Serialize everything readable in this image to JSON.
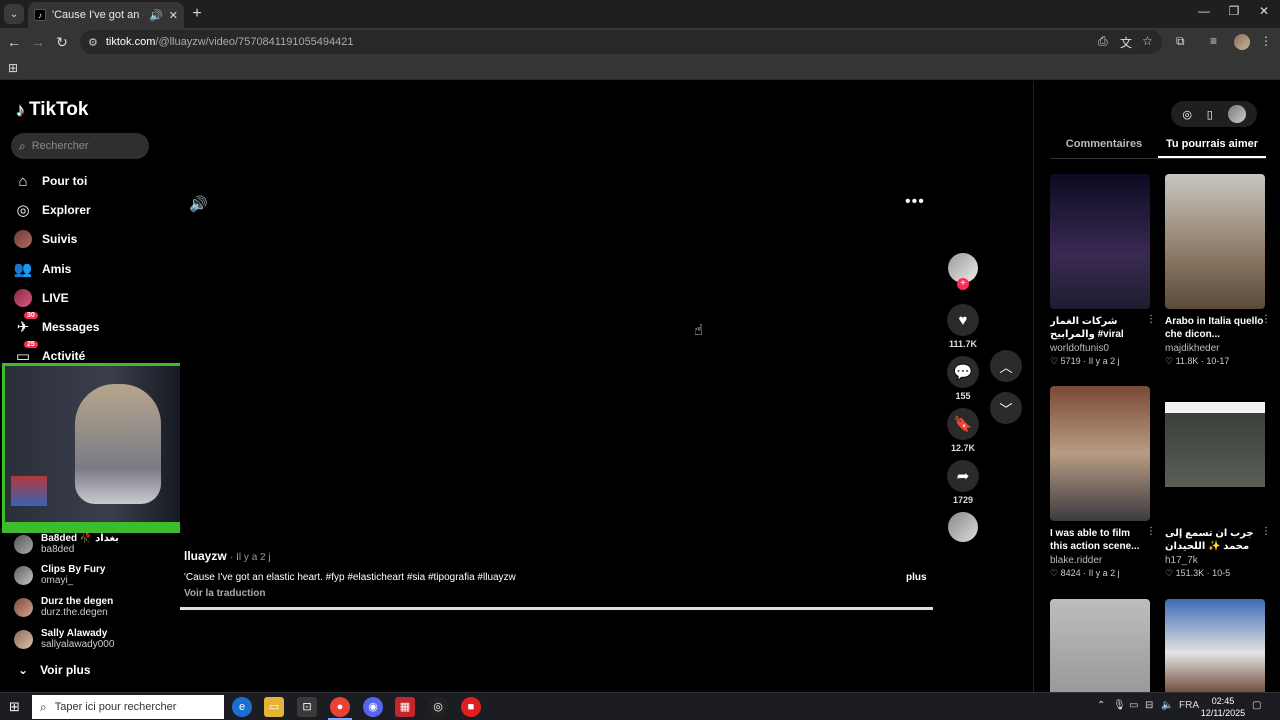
{
  "browser": {
    "tab_title": "'Cause I've got an elastic he...",
    "url_host": "tiktok.com",
    "url_path": "/@lluayzw/video/7570841191055494421"
  },
  "sidebar": {
    "logo_text": "TikTok",
    "search_placeholder": "Rechercher",
    "nav": [
      {
        "label": "Pour toi"
      },
      {
        "label": "Explorer"
      },
      {
        "label": "Suivis"
      },
      {
        "label": "Amis"
      },
      {
        "label": "LIVE"
      },
      {
        "label": "Messages",
        "badge": "30"
      },
      {
        "label": "Activité",
        "badge": "25"
      }
    ],
    "following": [
      {
        "name": "Ba8ded 🥀 بغداد",
        "handle": "ba8ded"
      },
      {
        "name": "Clips By Fury",
        "handle": "omayi_"
      },
      {
        "name": "Durz the degen",
        "handle": "durz.the.degen"
      },
      {
        "name": "Sally Alawady",
        "handle": "sallyalawady000"
      }
    ],
    "see_more": "Voir plus"
  },
  "video": {
    "author": "lluayzw",
    "time": "· Il y a 2 j",
    "caption": "'Cause I've got an elastic heart. #fyp #elasticheart #sia #tipografia #lluayzw",
    "more": "plus",
    "translate": "Voir la traduction",
    "progress": 1.0
  },
  "actions": {
    "likes": "111.7K",
    "comments": "155",
    "saves": "12.7K",
    "shares": "1729"
  },
  "side_panel": {
    "tabs": [
      "Commentaires",
      "Tu pourrais aimer"
    ],
    "active_tab": 1,
    "cards": [
      {
        "title": "شركات الغمار والمرابيح #viral",
        "user": "worldoftunis0",
        "meta": "♡ 5719 · Il y a 2 j",
        "thumb": "linear-gradient(180deg,#0b0b22,#3a2a52 60%,#1c1c2e)"
      },
      {
        "title": "Arabo in Italia quello che dicon...",
        "user": "majdikheder",
        "meta": "♡ 11.8K · 10-17",
        "thumb": "linear-gradient(180deg,#c9c6bf,#8c7a66 60%,#5a4a3a)"
      },
      {
        "title": "I was able to film this action scene...",
        "user": "blake.ridder",
        "meta": "♡ 8424 · Il y a 2 j",
        "thumb": "linear-gradient(180deg,#7a4a36,#b79c84 50%,#3c3a3e)"
      },
      {
        "title": "جرب ان تسمع إلى محمد ✨ اللحيدان راحه نفسيه...",
        "user": "h17_7k",
        "meta": "♡ 151.3K · 10-5",
        "thumb": "linear-gradient(180deg,#000 0%,#000 12%,#f2f2f2 12%,#f2f2f2 20%,#3a3f38 20%,#5b5f57 75%,#000 75%)"
      },
      {
        "title": "",
        "user": "",
        "meta": "",
        "thumb": "linear-gradient(180deg,#bdbdbd,#8a8a8a)"
      },
      {
        "title": "",
        "user": "",
        "meta": "",
        "thumb": "linear-gradient(180deg,#3d6bb3,#e4e4e4 40%,#6d4a38 70%)"
      }
    ]
  },
  "taskbar": {
    "search_placeholder": "Taper ici pour rechercher",
    "lang": "FRA",
    "time": "02:45",
    "date": "12/11/2025"
  },
  "colors": {
    "accent": "#fe2c55",
    "webcam_border": "#3dbd2e",
    "panel_bg": "#000000"
  }
}
